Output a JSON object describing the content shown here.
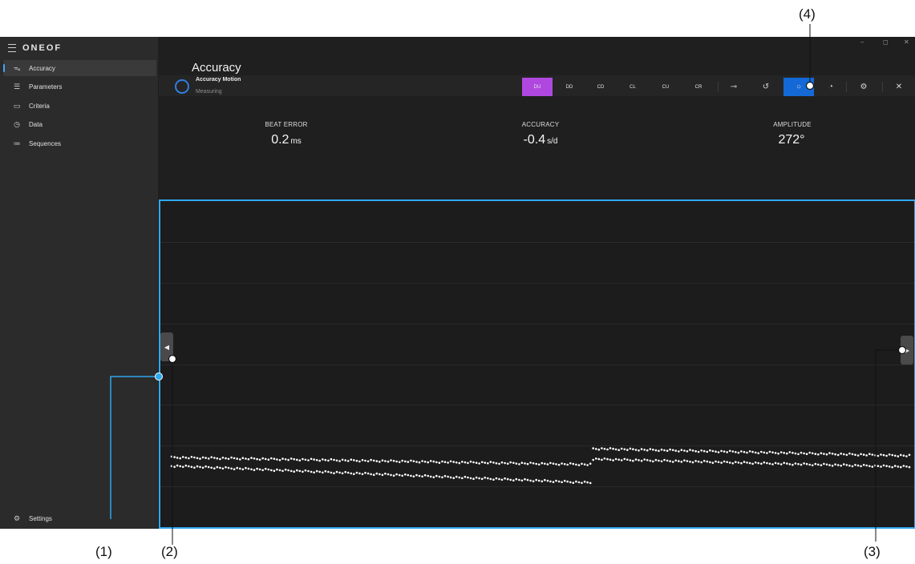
{
  "sidebar": {
    "brand": "ONEOF",
    "items": [
      {
        "label": "Accuracy",
        "icon": "accuracy-icon",
        "selected": true
      },
      {
        "label": "Parameters",
        "icon": "sliders-icon",
        "selected": false
      },
      {
        "label": "Criteria",
        "icon": "monitor-icon",
        "selected": false
      },
      {
        "label": "Data",
        "icon": "stopwatch-icon",
        "selected": false
      },
      {
        "label": "Sequences",
        "icon": "list-icon",
        "selected": false
      }
    ],
    "settings_label": "Settings"
  },
  "header": {
    "title": "Accuracy",
    "mode_title": "Accuracy Motion",
    "mode_status": "Measuring"
  },
  "toolbar": {
    "positions": [
      "DU",
      "DD",
      "CD",
      "CL",
      "CU",
      "CR"
    ],
    "active_position": "DU",
    "active_color": "#b048e0",
    "active_icon_color": "#1469d6",
    "icons": [
      "balance-icon",
      "history-icon",
      "record-icon",
      "chart-icon",
      "settings-icon",
      "close-icon"
    ]
  },
  "readouts": [
    {
      "label": "BEAT ERROR",
      "value": "0.2",
      "unit": "ms"
    },
    {
      "label": "ACCURACY",
      "value": "-0.4",
      "unit": "s/d"
    },
    {
      "label": "AMPLITUDE",
      "value": "272°",
      "unit": ""
    }
  ],
  "callouts": [
    "(1)",
    "(2)",
    "(3)",
    "(4)"
  ],
  "accent_color": "#2fa8f0",
  "chart_data": {
    "type": "scatter",
    "grid": true,
    "gridline_count": 7,
    "point_color": "#ffffff",
    "series": [
      {
        "values_fraction_of_plot_height": {
          "start": 0.786,
          "end": 0.808,
          "step_at_fraction": 0.57,
          "after_start": 0.759,
          "after_end": 0.781
        }
      },
      {
        "values_fraction_of_plot_height": {
          "start": 0.812,
          "end": 0.864,
          "step_at_fraction": 0.57,
          "after_start": 0.791,
          "after_end": 0.815
        }
      }
    ]
  }
}
